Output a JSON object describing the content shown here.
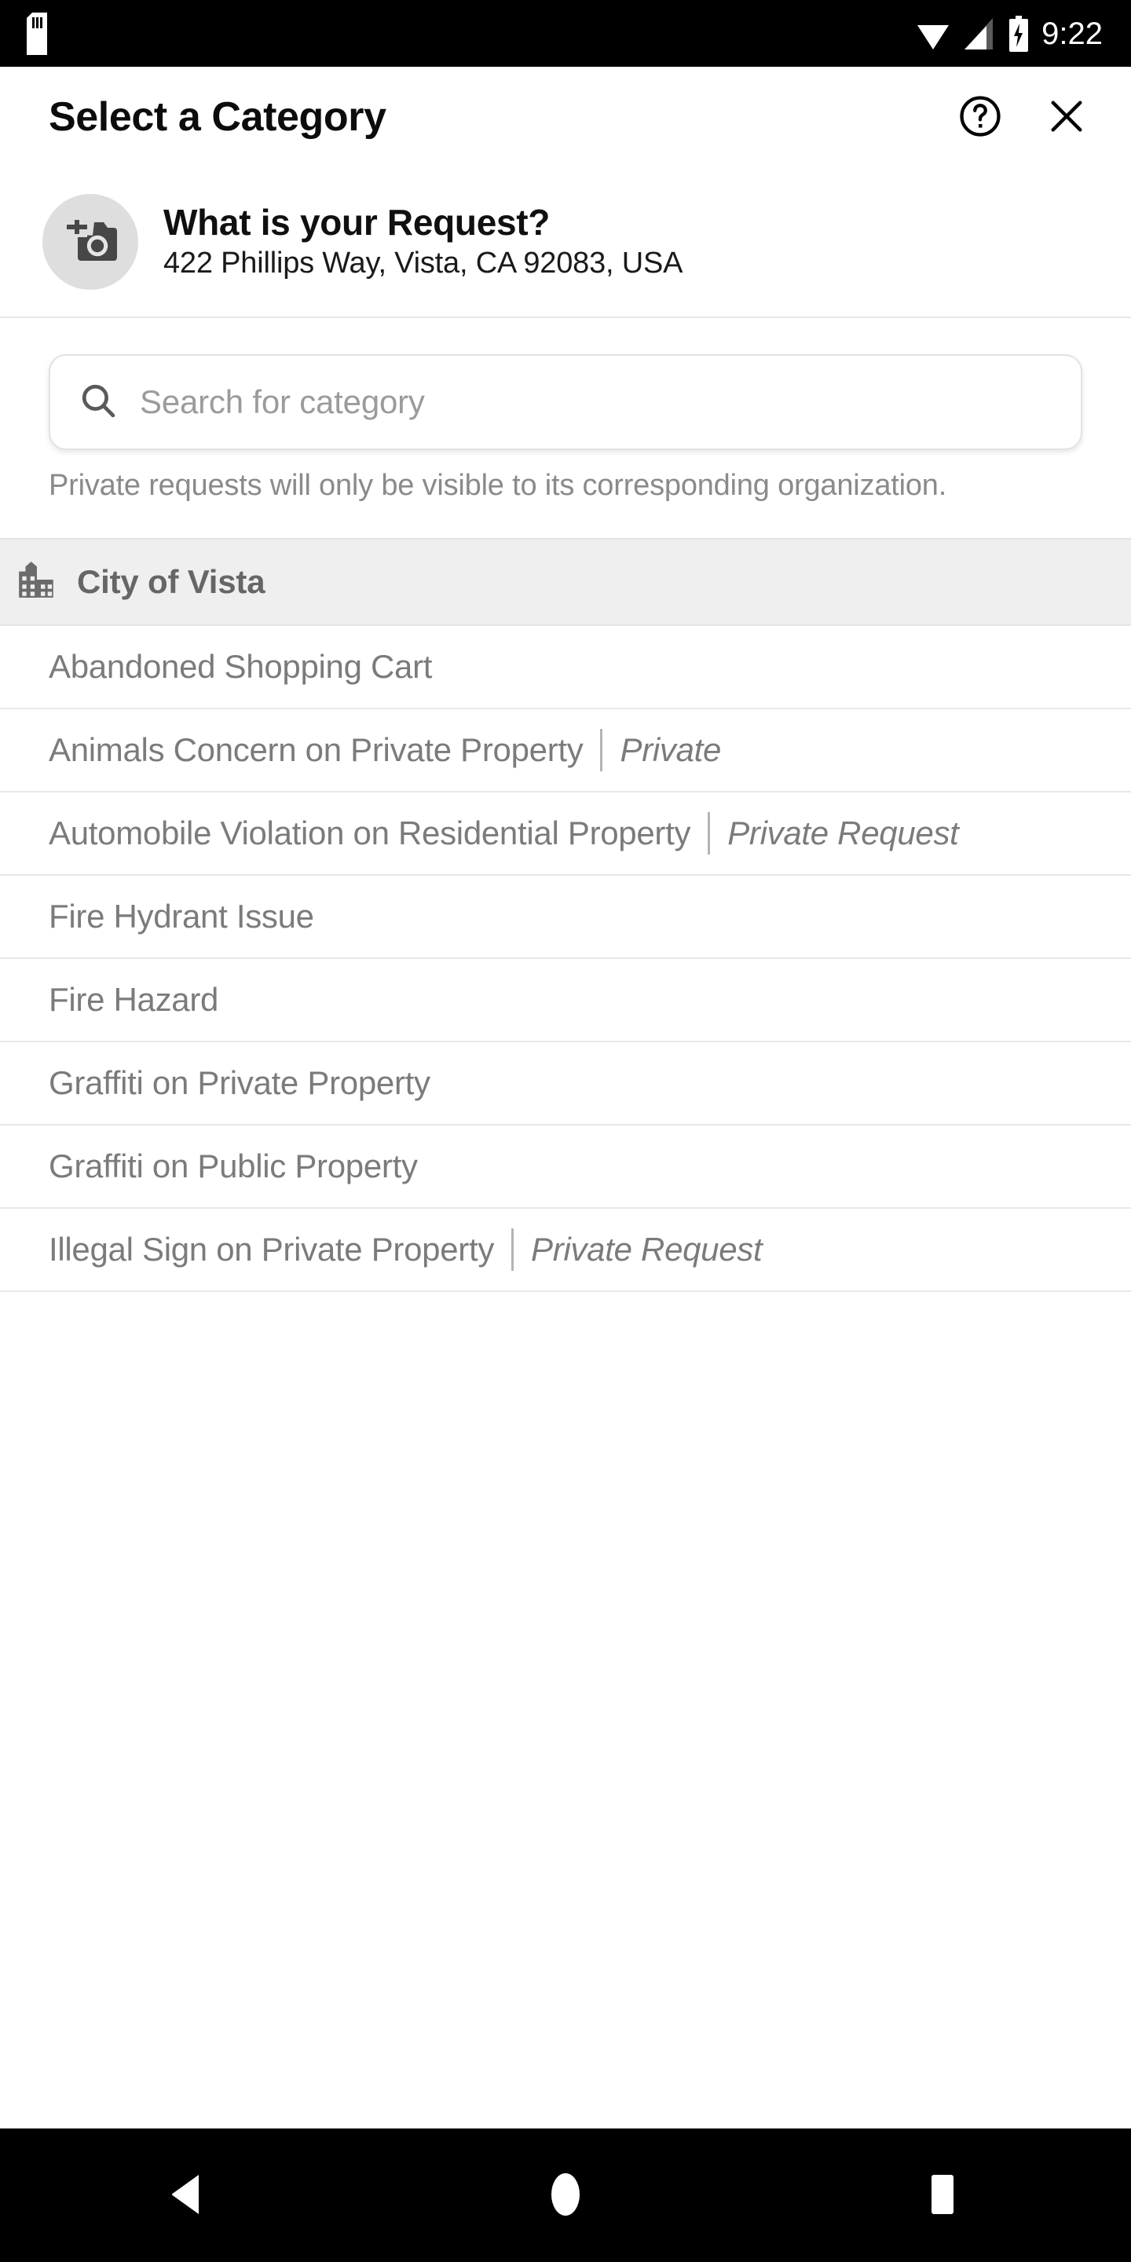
{
  "status_bar": {
    "time": "9:22",
    "icons": {
      "sd_card": "sd-card-icon",
      "wifi": "wifi-icon",
      "signal": "signal-icon",
      "battery": "battery-charging-icon"
    }
  },
  "header": {
    "title": "Select a Category",
    "help_icon": "help-circle-icon",
    "close_icon": "close-icon"
  },
  "request": {
    "avatar_icon": "add-photo-camera-icon",
    "title": "What is your Request?",
    "address": "422 Phillips Way, Vista, CA 92083, USA"
  },
  "search": {
    "icon": "search-icon",
    "value": "",
    "placeholder": "Search for category"
  },
  "privacy_note": "Private requests will only be visible to its corresponding organization.",
  "section": {
    "icon": "city-building-icon",
    "title": "City of Vista"
  },
  "categories": [
    {
      "label": "Abandoned Shopping Cart",
      "badge": ""
    },
    {
      "label": "Animals Concern on Private Property",
      "badge": "Private"
    },
    {
      "label": "Automobile Violation on Residential Property",
      "badge": "Private Request"
    },
    {
      "label": "Fire Hydrant Issue",
      "badge": ""
    },
    {
      "label": "Fire Hazard",
      "badge": ""
    },
    {
      "label": "Graffiti on Private Property",
      "badge": ""
    },
    {
      "label": "Graffiti on Public Property",
      "badge": ""
    },
    {
      "label": "Illegal Sign on Private Property",
      "badge": "Private Request"
    }
  ],
  "nav_bar": {
    "back_icon": "back-triangle-icon",
    "home_icon": "home-circle-icon",
    "recents_icon": "recents-square-icon"
  },
  "colors": {
    "status_bar_bg": "#000000",
    "page_bg": "#ffffff",
    "section_bg": "#efefef",
    "text_primary": "#101010",
    "text_muted": "#7b7b7b",
    "divider": "#e8e8e8",
    "avatar_bg": "#dedede"
  }
}
